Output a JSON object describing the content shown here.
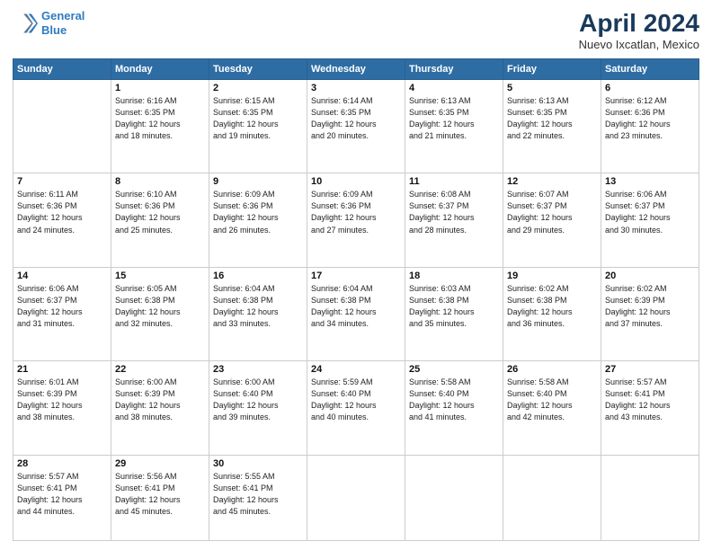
{
  "header": {
    "logo_line1": "General",
    "logo_line2": "Blue",
    "title": "April 2024",
    "location": "Nuevo Ixcatlan, Mexico"
  },
  "weekdays": [
    "Sunday",
    "Monday",
    "Tuesday",
    "Wednesday",
    "Thursday",
    "Friday",
    "Saturday"
  ],
  "weeks": [
    [
      {
        "num": "",
        "info": ""
      },
      {
        "num": "1",
        "info": "Sunrise: 6:16 AM\nSunset: 6:35 PM\nDaylight: 12 hours\nand 18 minutes."
      },
      {
        "num": "2",
        "info": "Sunrise: 6:15 AM\nSunset: 6:35 PM\nDaylight: 12 hours\nand 19 minutes."
      },
      {
        "num": "3",
        "info": "Sunrise: 6:14 AM\nSunset: 6:35 PM\nDaylight: 12 hours\nand 20 minutes."
      },
      {
        "num": "4",
        "info": "Sunrise: 6:13 AM\nSunset: 6:35 PM\nDaylight: 12 hours\nand 21 minutes."
      },
      {
        "num": "5",
        "info": "Sunrise: 6:13 AM\nSunset: 6:35 PM\nDaylight: 12 hours\nand 22 minutes."
      },
      {
        "num": "6",
        "info": "Sunrise: 6:12 AM\nSunset: 6:36 PM\nDaylight: 12 hours\nand 23 minutes."
      }
    ],
    [
      {
        "num": "7",
        "info": "Sunrise: 6:11 AM\nSunset: 6:36 PM\nDaylight: 12 hours\nand 24 minutes."
      },
      {
        "num": "8",
        "info": "Sunrise: 6:10 AM\nSunset: 6:36 PM\nDaylight: 12 hours\nand 25 minutes."
      },
      {
        "num": "9",
        "info": "Sunrise: 6:09 AM\nSunset: 6:36 PM\nDaylight: 12 hours\nand 26 minutes."
      },
      {
        "num": "10",
        "info": "Sunrise: 6:09 AM\nSunset: 6:36 PM\nDaylight: 12 hours\nand 27 minutes."
      },
      {
        "num": "11",
        "info": "Sunrise: 6:08 AM\nSunset: 6:37 PM\nDaylight: 12 hours\nand 28 minutes."
      },
      {
        "num": "12",
        "info": "Sunrise: 6:07 AM\nSunset: 6:37 PM\nDaylight: 12 hours\nand 29 minutes."
      },
      {
        "num": "13",
        "info": "Sunrise: 6:06 AM\nSunset: 6:37 PM\nDaylight: 12 hours\nand 30 minutes."
      }
    ],
    [
      {
        "num": "14",
        "info": "Sunrise: 6:06 AM\nSunset: 6:37 PM\nDaylight: 12 hours\nand 31 minutes."
      },
      {
        "num": "15",
        "info": "Sunrise: 6:05 AM\nSunset: 6:38 PM\nDaylight: 12 hours\nand 32 minutes."
      },
      {
        "num": "16",
        "info": "Sunrise: 6:04 AM\nSunset: 6:38 PM\nDaylight: 12 hours\nand 33 minutes."
      },
      {
        "num": "17",
        "info": "Sunrise: 6:04 AM\nSunset: 6:38 PM\nDaylight: 12 hours\nand 34 minutes."
      },
      {
        "num": "18",
        "info": "Sunrise: 6:03 AM\nSunset: 6:38 PM\nDaylight: 12 hours\nand 35 minutes."
      },
      {
        "num": "19",
        "info": "Sunrise: 6:02 AM\nSunset: 6:38 PM\nDaylight: 12 hours\nand 36 minutes."
      },
      {
        "num": "20",
        "info": "Sunrise: 6:02 AM\nSunset: 6:39 PM\nDaylight: 12 hours\nand 37 minutes."
      }
    ],
    [
      {
        "num": "21",
        "info": "Sunrise: 6:01 AM\nSunset: 6:39 PM\nDaylight: 12 hours\nand 38 minutes."
      },
      {
        "num": "22",
        "info": "Sunrise: 6:00 AM\nSunset: 6:39 PM\nDaylight: 12 hours\nand 38 minutes."
      },
      {
        "num": "23",
        "info": "Sunrise: 6:00 AM\nSunset: 6:40 PM\nDaylight: 12 hours\nand 39 minutes."
      },
      {
        "num": "24",
        "info": "Sunrise: 5:59 AM\nSunset: 6:40 PM\nDaylight: 12 hours\nand 40 minutes."
      },
      {
        "num": "25",
        "info": "Sunrise: 5:58 AM\nSunset: 6:40 PM\nDaylight: 12 hours\nand 41 minutes."
      },
      {
        "num": "26",
        "info": "Sunrise: 5:58 AM\nSunset: 6:40 PM\nDaylight: 12 hours\nand 42 minutes."
      },
      {
        "num": "27",
        "info": "Sunrise: 5:57 AM\nSunset: 6:41 PM\nDaylight: 12 hours\nand 43 minutes."
      }
    ],
    [
      {
        "num": "28",
        "info": "Sunrise: 5:57 AM\nSunset: 6:41 PM\nDaylight: 12 hours\nand 44 minutes."
      },
      {
        "num": "29",
        "info": "Sunrise: 5:56 AM\nSunset: 6:41 PM\nDaylight: 12 hours\nand 45 minutes."
      },
      {
        "num": "30",
        "info": "Sunrise: 5:55 AM\nSunset: 6:41 PM\nDaylight: 12 hours\nand 45 minutes."
      },
      {
        "num": "",
        "info": ""
      },
      {
        "num": "",
        "info": ""
      },
      {
        "num": "",
        "info": ""
      },
      {
        "num": "",
        "info": ""
      }
    ]
  ]
}
